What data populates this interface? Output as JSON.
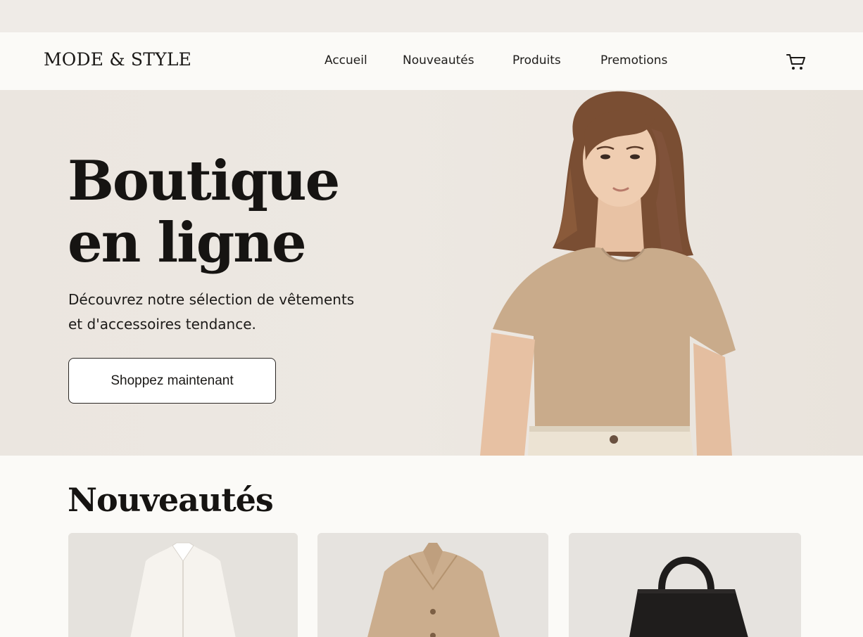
{
  "header": {
    "logo": "MODE & STYLE",
    "nav": [
      "Accueil",
      "Nouveautés",
      "Produits",
      "Premotions"
    ],
    "cart_icon": "shopping-cart-icon"
  },
  "hero": {
    "title_line1": "Boutique",
    "title_line2": "en ligne",
    "subtitle_line1": "Découvrez notre sélection de vêtements",
    "subtitle_line2": "et d'accessoires tendance.",
    "cta_label": "Shoppez maintenant"
  },
  "new_arrivals": {
    "title": "Nouveautés",
    "products": [
      {
        "image": "white-blouse"
      },
      {
        "image": "beige-wool-coat"
      },
      {
        "image": "black-leather-handbag"
      }
    ]
  },
  "colors": {
    "background": "#fbfaf7",
    "hero_background": "#ebe6e0",
    "text": "#161412",
    "accent_beige": "#c9ab8b"
  }
}
